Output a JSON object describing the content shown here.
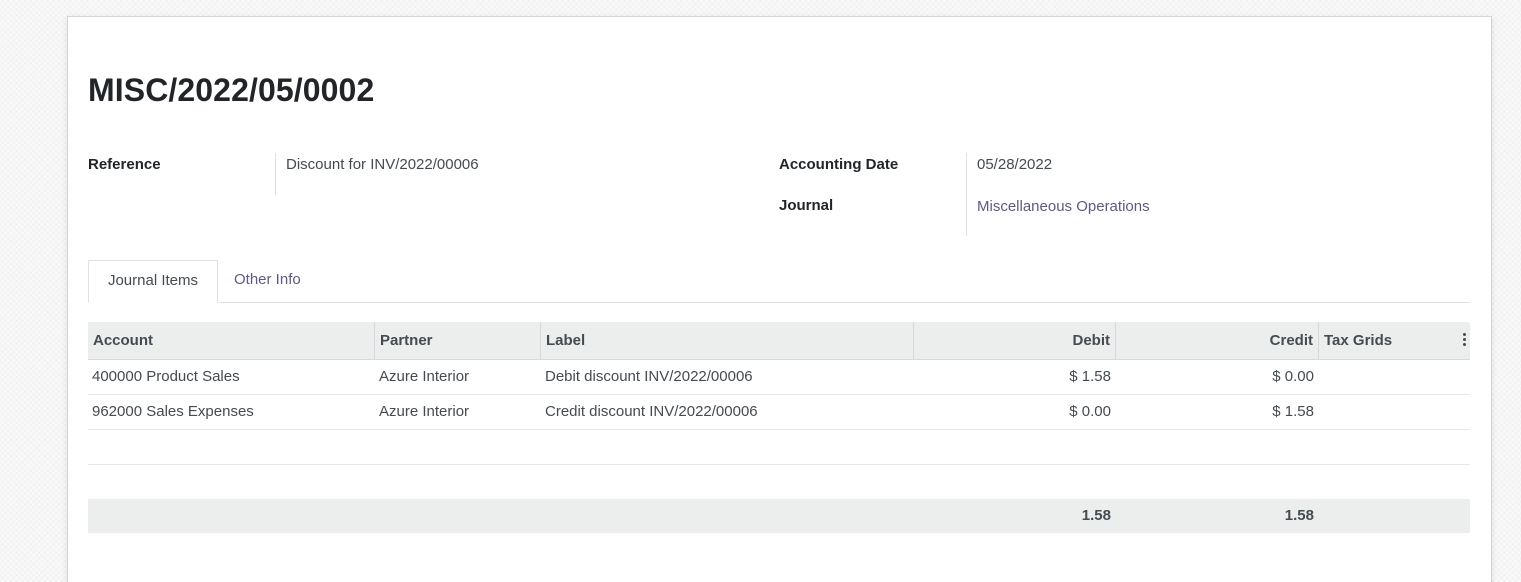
{
  "record": {
    "title": "MISC/2022/05/0002"
  },
  "fields": {
    "reference_label": "Reference",
    "reference_value": "Discount for INV/2022/00006",
    "accounting_date_label": "Accounting Date",
    "accounting_date_value": "05/28/2022",
    "journal_label": "Journal",
    "journal_value": "Miscellaneous Operations"
  },
  "tabs": [
    {
      "label": "Journal Items",
      "active": true
    },
    {
      "label": "Other Info",
      "active": false
    }
  ],
  "table": {
    "columns": [
      "Account",
      "Partner",
      "Label",
      "Debit",
      "Credit",
      "Tax Grids"
    ],
    "rows": [
      {
        "account": "400000 Product Sales",
        "partner": "Azure Interior",
        "label": "Debit discount INV/2022/00006",
        "debit": "$ 1.58",
        "credit": "$ 0.00",
        "tax_grids": ""
      },
      {
        "account": "962000 Sales Expenses",
        "partner": "Azure Interior",
        "label": "Credit discount INV/2022/00006",
        "debit": "$ 0.00",
        "credit": "$ 1.58",
        "tax_grids": ""
      }
    ],
    "totals": {
      "debit": "1.58",
      "credit": "1.58"
    }
  },
  "icons": {
    "column_options": "vertical-ellipsis-icon"
  },
  "colors": {
    "link": "#5e5a82",
    "header_bg": "#eceded",
    "text": "#444b51"
  }
}
